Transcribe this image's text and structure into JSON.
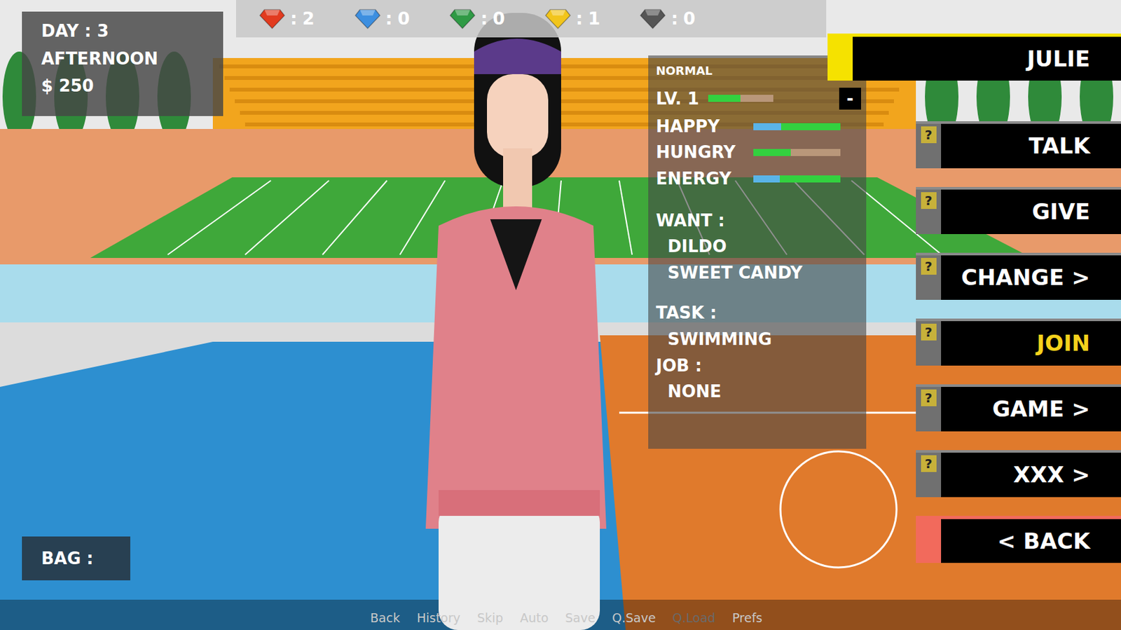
{
  "hud": {
    "day": "DAY : 3",
    "time": "AFTERNOON",
    "money": "$ 250"
  },
  "gems": [
    {
      "count": "2",
      "color": "#e23b1f"
    },
    {
      "count": "0",
      "color": "#3d8fe0"
    },
    {
      "count": "0",
      "color": "#2f9a45"
    },
    {
      "count": "1",
      "color": "#f2c51c"
    },
    {
      "count": "0",
      "color": "#555555"
    }
  ],
  "gem_separator": ":",
  "character": {
    "name": "JULIE",
    "mood": "NORMAL",
    "level_label": "LV. 1",
    "level": 0.5
  },
  "minimize": "-",
  "stats": [
    {
      "label": "HAPPY",
      "level": 1.0,
      "boost": 0.32
    },
    {
      "label": "HUNGRY",
      "level": 0.43,
      "boost": 0
    },
    {
      "label": "ENERGY",
      "level": 1.0,
      "boost": 0.3
    }
  ],
  "want": {
    "label": "WANT :",
    "items": [
      "DILDO",
      "SWEET CANDY"
    ]
  },
  "task": {
    "label": "TASK :",
    "value": "SWIMMING"
  },
  "job": {
    "label": "JOB :",
    "value": "NONE"
  },
  "actions": [
    {
      "label": "TALK",
      "hint": "?",
      "highlighted": false
    },
    {
      "label": "GIVE",
      "hint": "?",
      "highlighted": false
    },
    {
      "label": "CHANGE >",
      "hint": "?",
      "highlighted": false
    },
    {
      "label": "JOIN",
      "hint": "?",
      "highlighted": true
    },
    {
      "label": "GAME >",
      "hint": "?",
      "highlighted": false
    },
    {
      "label": "XXX >",
      "hint": "?",
      "highlighted": false
    }
  ],
  "back": "< BACK",
  "bag": {
    "label": "BAG :"
  },
  "quick_menu": [
    {
      "label": "Back",
      "disabled": false
    },
    {
      "label": "History",
      "disabled": false
    },
    {
      "label": "Skip",
      "disabled": false
    },
    {
      "label": "Auto",
      "disabled": false
    },
    {
      "label": "Save",
      "disabled": false
    },
    {
      "label": "Q.Save",
      "disabled": false
    },
    {
      "label": "Q.Load",
      "disabled": true
    },
    {
      "label": "Prefs",
      "disabled": false
    }
  ]
}
